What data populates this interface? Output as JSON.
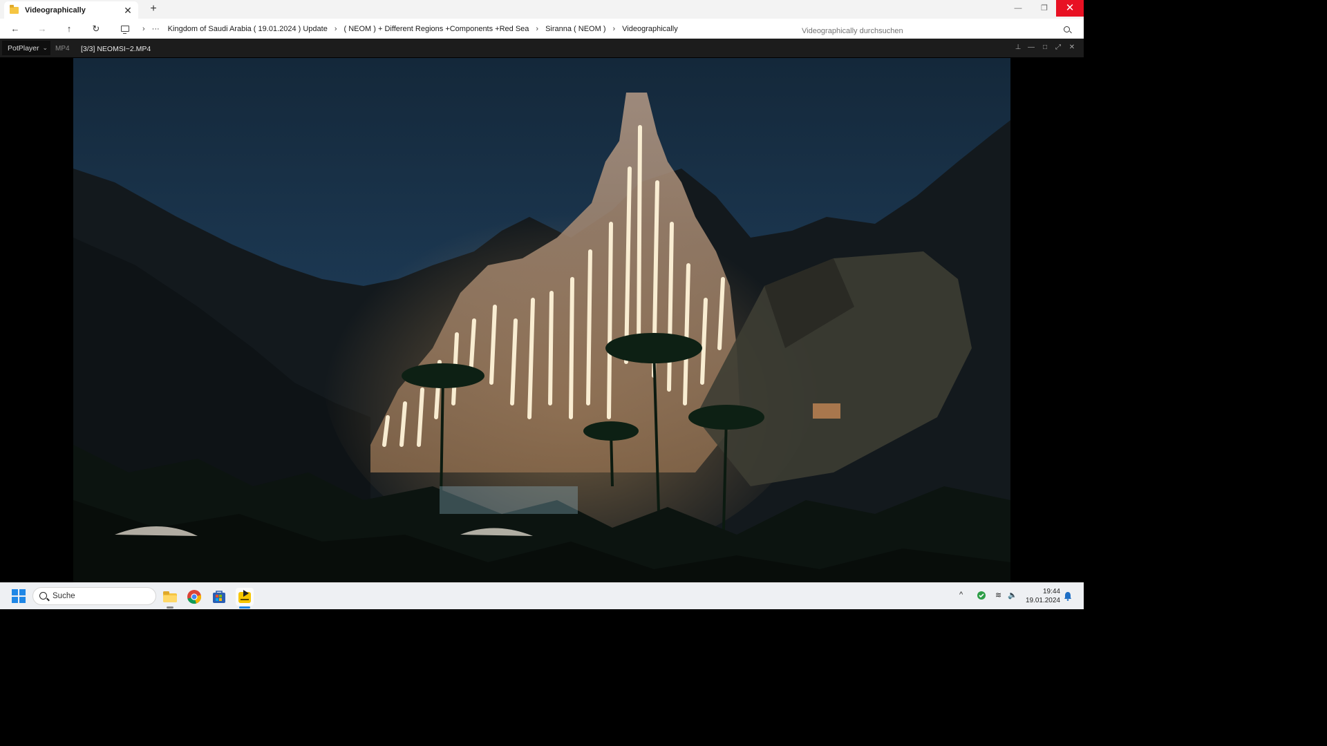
{
  "explorer": {
    "tab": {
      "title": "Videographically",
      "close_glyph": "✕"
    },
    "new_tab_glyph": "+",
    "window_controls": {
      "minimize": "—",
      "maximize": "❐",
      "close": "✕"
    },
    "nav": {
      "back": "←",
      "forward": "→",
      "up": "↑",
      "refresh": "↻",
      "more": "···"
    },
    "breadcrumbs": [
      "Kingdom of Saudi Arabia ( 19.01.2024 ) Update",
      "( NEOM ) + Different Regions +Components +Red Sea",
      "Siranna ( NEOM )",
      "Videographically"
    ],
    "breadcrumb_separator": "›",
    "search": {
      "placeholder": "Videographically durchsuchen"
    }
  },
  "player": {
    "menu_label": "PotPlayer",
    "menu_caret": "⌄",
    "format": "MP4",
    "file_title": "[3/3] NEOMSI~2.MP4",
    "controls": {
      "pin": "⊥",
      "minimize": "—",
      "maximize": "□",
      "fullscreen": "⤢",
      "close": "✕"
    }
  },
  "taskbar": {
    "search_label": "Suche",
    "tray": {
      "chevron": "^",
      "wifi": "≋",
      "volume": "🔈"
    },
    "clock": {
      "time": "19:44",
      "date": "19.01.2024"
    }
  },
  "colors": {
    "accent": "#1f87e6",
    "close_red": "#e81123",
    "folder_yellow": "#f5c542",
    "player_bg": "#000000",
    "player_title_bg": "#1c1c1c"
  }
}
